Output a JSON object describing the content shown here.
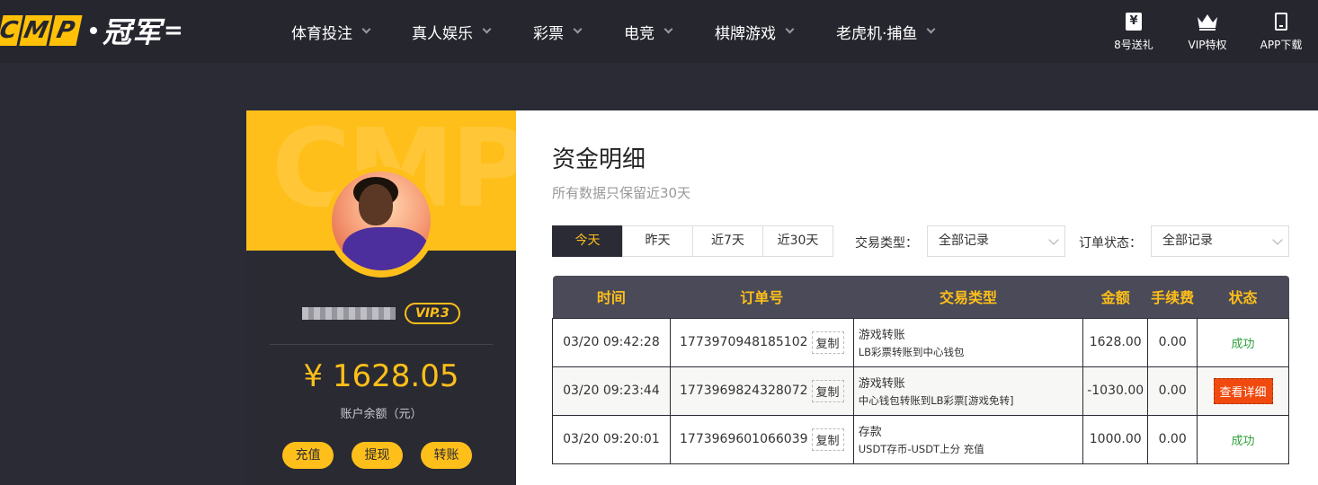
{
  "header": {
    "logo": {
      "letters": [
        "C",
        "M",
        "P"
      ],
      "name": "冠军",
      "tail": "="
    },
    "nav": [
      "体育投注",
      "真人娱乐",
      "彩票",
      "电竞",
      "棋牌游戏",
      "老虎机·捕鱼"
    ],
    "links": [
      {
        "label": "8号送礼",
        "icon": "gift-icon",
        "glyph": "¥"
      },
      {
        "label": "VIP特权",
        "icon": "crown-icon"
      },
      {
        "label": "APP下载",
        "icon": "phone-icon"
      }
    ]
  },
  "profile": {
    "watermark": "CMP",
    "vip": "VIP.3",
    "balance": "¥ 1628.05",
    "balance_label": "账户余额（元）",
    "actions": [
      "充值",
      "提现",
      "转账"
    ]
  },
  "funds": {
    "title": "资金明细",
    "subtitle": "所有数据只保留近30天",
    "date_tabs": [
      "今天",
      "昨天",
      "近7天",
      "近30天"
    ],
    "active_tab": 0,
    "filters": {
      "type_label": "交易类型：",
      "type_value": "全部记录",
      "status_label": "订单状态：",
      "status_value": "全部记录"
    },
    "columns": [
      "时间",
      "订单号",
      "交易类型",
      "金额",
      "手续费",
      "状态"
    ],
    "copy_label": "复制",
    "rows": [
      {
        "time": "03/20 09:42:28",
        "order": "1773970948185102",
        "type": "游戏转账",
        "type_detail": "LB彩票转账到中心钱包",
        "amount": "1628.00",
        "fee": "0.00",
        "status": "成功",
        "status_kind": "ok"
      },
      {
        "time": "03/20 09:23:44",
        "order": "1773969824328072",
        "type": "游戏转账",
        "type_detail": "中心钱包转账到LB彩票[游戏免转]",
        "amount": "-1030.00",
        "fee": "0.00",
        "status": "查看详细",
        "status_kind": "button"
      },
      {
        "time": "03/20 09:20:01",
        "order": "1773969601066039",
        "type": "存款",
        "type_detail": "USDT存币-USDT上分 充值",
        "amount": "1000.00",
        "fee": "0.00",
        "status": "成功",
        "status_kind": "ok"
      }
    ]
  },
  "colors": {
    "accent": "#ffbf1a",
    "dark": "#26262f",
    "success": "#2ea03a",
    "danger": "#f04a0f"
  }
}
